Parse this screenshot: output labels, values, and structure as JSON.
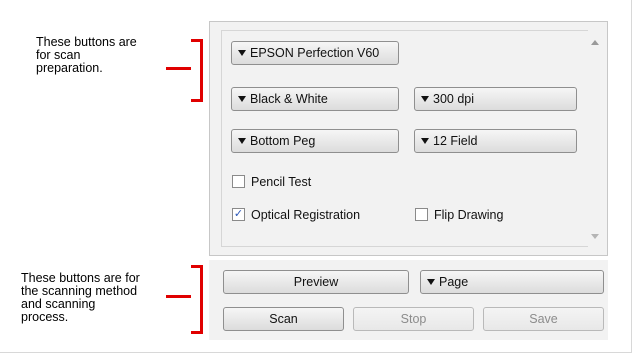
{
  "annotations": {
    "top": [
      "These buttons are",
      "for scan",
      "preparation."
    ],
    "bottom": [
      "These buttons are for",
      "the scanning method",
      "and scanning",
      "process."
    ]
  },
  "settings": {
    "scanner": "EPSON Perfection V60",
    "color_mode": "Black & White",
    "resolution": "300 dpi",
    "peg": "Bottom Peg",
    "field": "12 Field"
  },
  "options": {
    "pencil_test": {
      "label": "Pencil Test",
      "checked": false
    },
    "optical_registration": {
      "label": "Optical Registration",
      "checked": true
    },
    "flip_drawing": {
      "label": "Flip Drawing",
      "checked": false
    }
  },
  "actions": {
    "preview": "Preview",
    "scan_method": "Page",
    "scan": "Scan",
    "stop": "Stop",
    "save": "Save"
  },
  "colors": {
    "annotation_bracket": "#e00000",
    "check_mark": "#2a56b8"
  }
}
